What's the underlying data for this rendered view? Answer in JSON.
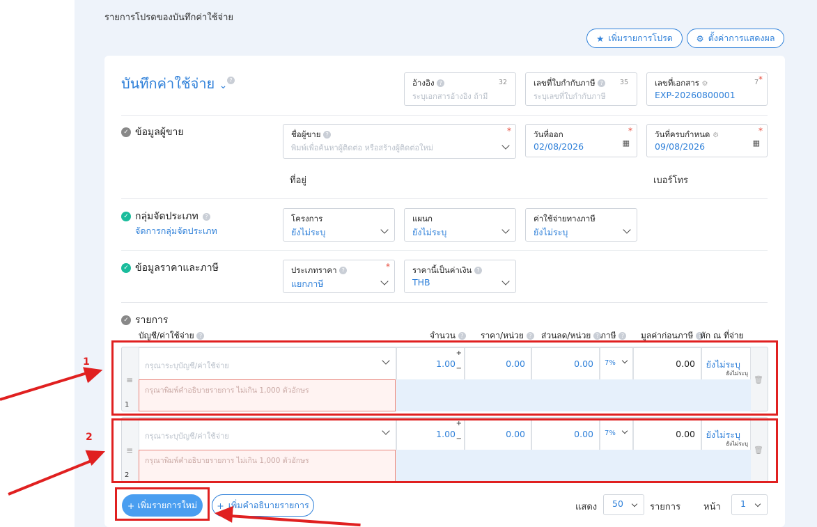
{
  "page_title": "รายการโปรดของบันทึกค่าใช้จ่าย",
  "add_favorite_label": "เพิ่มรายการโปรด",
  "display_settings_label": "ตั้งค่าการแสดงผล",
  "doc_title": "บันทึกค่าใช้จ่าย",
  "fields": {
    "reference": {
      "label": "อ้างอิง",
      "placeholder": "ระบุเอกสารอ้างอิง ถ้ามี",
      "count": "32"
    },
    "tax_invoice": {
      "label": "เลขที่ใบกำกับภาษี",
      "placeholder": "ระบุเลขที่ใบกำกับภาษี",
      "count": "35"
    },
    "doc_no": {
      "label": "เลขที่เอกสาร",
      "value": "EXP-20260800001",
      "count": "7"
    },
    "vendor": {
      "label": "ชื่อผู้ขาย",
      "placeholder": "พิมพ์เพื่อค้นหาผู้ติดต่อ หรือสร้างผู้ติดต่อใหม่"
    },
    "issue_date": {
      "label": "วันที่ออก",
      "value": "02/08/2026"
    },
    "due_date": {
      "label": "วันที่ครบกำหนด",
      "value": "09/08/2026"
    },
    "project": {
      "label": "โครงการ",
      "value": "ยังไม่ระบุ"
    },
    "department": {
      "label": "แผนก",
      "value": "ยังไม่ระบุ"
    },
    "tax_expense": {
      "label": "ค่าใช้จ่ายทางภาษี",
      "value": "ยังไม่ระบุ"
    },
    "price_type": {
      "label": "ประเภทราคา",
      "value": "แยกภาษี"
    },
    "currency": {
      "label": "ราคานี้เป็นค่าเงิน",
      "value": "THB"
    }
  },
  "sections": {
    "vendor_info": "ข้อมูลผู้ขาย",
    "address": "ที่อยู่",
    "phone": "เบอร์โทร",
    "category": "กลุ่มจัดประเภท",
    "manage_category": "จัดการกลุ่มจัดประเภท",
    "price_tax": "ข้อมูลราคาและภาษี",
    "items": "รายการ"
  },
  "columns": {
    "account": "บัญชี/ค่าใช้จ่าย",
    "qty": "จำนวน",
    "unit_price": "ราคา/หน่วย",
    "discount": "ส่วนลด/หน่วย",
    "tax": "ภาษี",
    "pretax": "มูลค่าก่อนภาษี",
    "withholding": "หัก ณ ที่จ่าย"
  },
  "rows": [
    {
      "no": "1",
      "account_ph": "กรุณาระบุบัญชี/ค่าใช้จ่าย",
      "desc_ph": "กรุณาพิมพ์คำอธิบายรายการ ไม่เกิน 1,000 ตัวอักษร",
      "qty": "1.00",
      "price": "0.00",
      "discount": "0.00",
      "tax": "7%",
      "pretax": "0.00",
      "wht": "ยังไม่ระบุ",
      "wht_sub": "ยังไม่ระบุ"
    },
    {
      "no": "2",
      "account_ph": "กรุณาระบุบัญชี/ค่าใช้จ่าย",
      "desc_ph": "กรุณาพิมพ์คำอธิบายรายการ ไม่เกิน 1,000 ตัวอักษร",
      "qty": "1.00",
      "price": "0.00",
      "discount": "0.00",
      "tax": "7%",
      "pretax": "0.00",
      "wht": "ยังไม่ระบุ",
      "wht_sub": "ยังไม่ระบุ"
    }
  ],
  "add_item_label": "เพิ่มรายการใหม่",
  "add_desc_label": "เพิ่มคำอธิบายรายการ",
  "pager": {
    "show": "แสดง",
    "per_page": "50",
    "items": "รายการ",
    "page": "หน้า",
    "current": "1"
  },
  "annotations": {
    "n1": "1",
    "n2": "2"
  }
}
